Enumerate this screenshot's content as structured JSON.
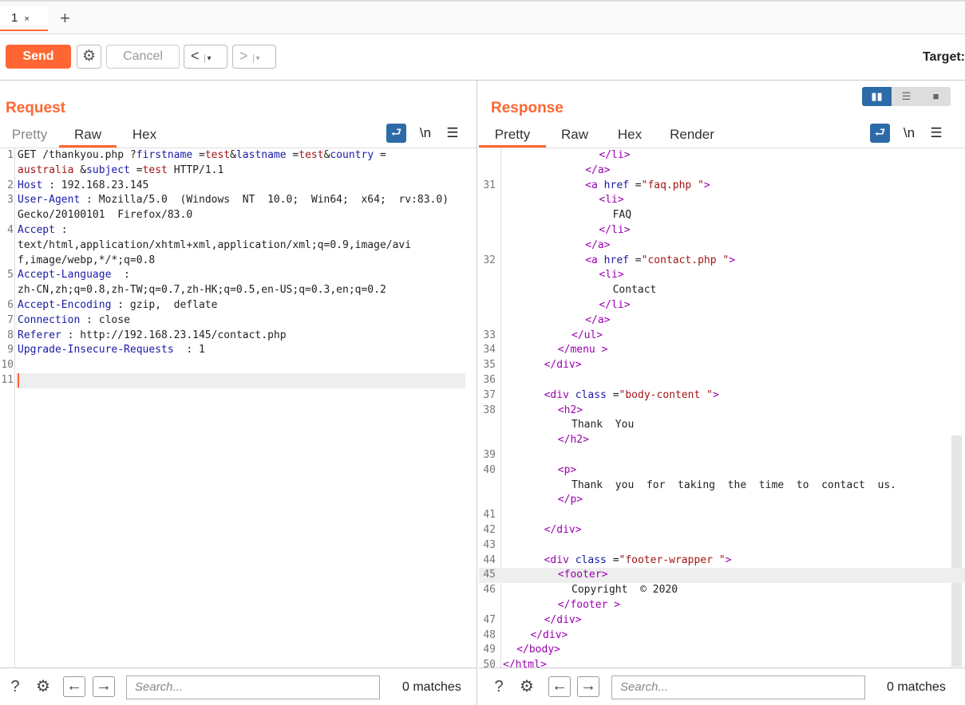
{
  "tabs": {
    "items": [
      {
        "label": "1",
        "close": "×"
      }
    ],
    "add": "+"
  },
  "toolbar": {
    "send": "Send",
    "cancel": "Cancel",
    "back": "<",
    "forward": ">",
    "dropdown": "▾",
    "target": "Target:"
  },
  "request": {
    "title": "Request",
    "tabs": [
      "Pretty",
      "Raw",
      "Hex"
    ],
    "active_tab": "Raw",
    "newline_label": "\\n",
    "lines": [
      {
        "n": "1",
        "parts": [
          [
            "GET /thankyou.php ?",
            ""
          ],
          [
            "firstname",
            "k"
          ],
          [
            " =",
            ""
          ],
          [
            "test",
            "v"
          ],
          [
            "&",
            ""
          ],
          [
            "lastname",
            "k"
          ],
          [
            " =",
            ""
          ],
          [
            "test",
            "v"
          ],
          [
            "&",
            ""
          ],
          [
            "country",
            "k"
          ],
          [
            " =",
            ""
          ]
        ]
      },
      {
        "n": "",
        "parts": [
          [
            "australia",
            "v"
          ],
          [
            " &",
            ""
          ],
          [
            "subject",
            "k"
          ],
          [
            " =",
            ""
          ],
          [
            "test",
            "v"
          ],
          [
            " HTTP/1.1",
            ""
          ]
        ]
      },
      {
        "n": "2",
        "parts": [
          [
            "Host",
            "k"
          ],
          [
            " : 192.168.23.145",
            ""
          ]
        ]
      },
      {
        "n": "3",
        "parts": [
          [
            "User-Agent",
            "k"
          ],
          [
            " : Mozilla/5.0  (Windows  NT  10.0;  Win64;  x64;  rv:83.0)",
            ""
          ]
        ]
      },
      {
        "n": "",
        "parts": [
          [
            "Gecko/20100101  Firefox/83.0",
            ""
          ]
        ]
      },
      {
        "n": "4",
        "parts": [
          [
            "Accept",
            "k"
          ],
          [
            " :",
            ""
          ]
        ]
      },
      {
        "n": "",
        "parts": [
          [
            "text/html,application/xhtml+xml,application/xml;q=0.9,image/avi",
            ""
          ]
        ]
      },
      {
        "n": "",
        "parts": [
          [
            "f,image/webp,*/*;q=0.8",
            ""
          ]
        ]
      },
      {
        "n": "5",
        "parts": [
          [
            "Accept-Language",
            "k"
          ],
          [
            "  :",
            ""
          ]
        ]
      },
      {
        "n": "",
        "parts": [
          [
            "zh-CN,zh;q=0.8,zh-TW;q=0.7,zh-HK;q=0.5,en-US;q=0.3,en;q=0.2",
            ""
          ]
        ]
      },
      {
        "n": "6",
        "parts": [
          [
            "Accept-Encoding",
            "k"
          ],
          [
            " : gzip,  deflate",
            ""
          ]
        ]
      },
      {
        "n": "7",
        "parts": [
          [
            "Connection",
            "k"
          ],
          [
            " : close",
            ""
          ]
        ]
      },
      {
        "n": "8",
        "parts": [
          [
            "Referer",
            "k"
          ],
          [
            " : http://192.168.23.145/contact.php",
            ""
          ]
        ]
      },
      {
        "n": "9",
        "parts": [
          [
            "Upgrade-Insecure-Requests",
            "k"
          ],
          [
            "  : 1",
            ""
          ]
        ]
      },
      {
        "n": "10",
        "parts": []
      },
      {
        "n": "11",
        "parts": [],
        "cursor": true
      }
    ],
    "footer": {
      "search_placeholder": "Search...",
      "matches": "0 matches"
    }
  },
  "response": {
    "title": "Response",
    "tabs": [
      "Pretty",
      "Raw",
      "Hex",
      "Render"
    ],
    "active_tab": "Pretty",
    "newline_label": "\\n",
    "lines": [
      {
        "n": "",
        "i": 7,
        "parts": [
          [
            "</li>",
            "t"
          ]
        ]
      },
      {
        "n": "",
        "i": 6,
        "parts": [
          [
            "</a>",
            "t"
          ]
        ]
      },
      {
        "n": "31",
        "i": 6,
        "parts": [
          [
            "<a ",
            "t"
          ],
          [
            "href",
            "k"
          ],
          [
            " =",
            ""
          ],
          [
            "\"faq.php \"",
            "v"
          ],
          [
            ">",
            "t"
          ]
        ]
      },
      {
        "n": "",
        "i": 7,
        "parts": [
          [
            "<li>",
            "t"
          ]
        ]
      },
      {
        "n": "",
        "i": 8,
        "parts": [
          [
            "FAQ",
            ""
          ]
        ]
      },
      {
        "n": "",
        "i": 7,
        "parts": [
          [
            "</li>",
            "t"
          ]
        ]
      },
      {
        "n": "",
        "i": 6,
        "parts": [
          [
            "</a>",
            "t"
          ]
        ]
      },
      {
        "n": "32",
        "i": 6,
        "parts": [
          [
            "<a ",
            "t"
          ],
          [
            "href",
            "k"
          ],
          [
            " =",
            ""
          ],
          [
            "\"contact.php \"",
            "v"
          ],
          [
            ">",
            "t"
          ]
        ]
      },
      {
        "n": "",
        "i": 7,
        "parts": [
          [
            "<li>",
            "t"
          ]
        ]
      },
      {
        "n": "",
        "i": 8,
        "parts": [
          [
            "Contact",
            ""
          ]
        ]
      },
      {
        "n": "",
        "i": 7,
        "parts": [
          [
            "</li>",
            "t"
          ]
        ]
      },
      {
        "n": "",
        "i": 6,
        "parts": [
          [
            "</a>",
            "t"
          ]
        ]
      },
      {
        "n": "33",
        "i": 5,
        "parts": [
          [
            "</ul>",
            "t"
          ]
        ]
      },
      {
        "n": "34",
        "i": 4,
        "parts": [
          [
            "</menu >",
            "t"
          ]
        ]
      },
      {
        "n": "35",
        "i": 3,
        "parts": [
          [
            "</div>",
            "t"
          ]
        ]
      },
      {
        "n": "36",
        "i": 0,
        "parts": []
      },
      {
        "n": "37",
        "i": 3,
        "parts": [
          [
            "<div ",
            "t"
          ],
          [
            "class",
            "k"
          ],
          [
            " =",
            ""
          ],
          [
            "\"body-content \"",
            "v"
          ],
          [
            ">",
            "t"
          ]
        ]
      },
      {
        "n": "38",
        "i": 4,
        "parts": [
          [
            "<h2>",
            "t"
          ]
        ]
      },
      {
        "n": "",
        "i": 5,
        "parts": [
          [
            "Thank  You",
            ""
          ]
        ]
      },
      {
        "n": "",
        "i": 4,
        "parts": [
          [
            "</h2>",
            "t"
          ]
        ]
      },
      {
        "n": "39",
        "i": 0,
        "parts": []
      },
      {
        "n": "40",
        "i": 4,
        "parts": [
          [
            "<p>",
            "t"
          ]
        ]
      },
      {
        "n": "",
        "i": 5,
        "parts": [
          [
            "Thank  you  for  taking  the  time  to  contact  us.",
            ""
          ]
        ]
      },
      {
        "n": "",
        "i": 4,
        "parts": [
          [
            "</p>",
            "t"
          ]
        ]
      },
      {
        "n": "41",
        "i": 0,
        "parts": []
      },
      {
        "n": "42",
        "i": 3,
        "parts": [
          [
            "</div>",
            "t"
          ]
        ]
      },
      {
        "n": "43",
        "i": 0,
        "parts": []
      },
      {
        "n": "44",
        "i": 3,
        "parts": [
          [
            "<div ",
            "t"
          ],
          [
            "class",
            "k"
          ],
          [
            " =",
            ""
          ],
          [
            "\"footer-wrapper \"",
            "v"
          ],
          [
            ">",
            "t"
          ]
        ]
      },
      {
        "n": "45",
        "i": 4,
        "parts": [
          [
            "<footer>",
            "t"
          ]
        ],
        "hl": true
      },
      {
        "n": "46",
        "i": 5,
        "parts": [
          [
            "Copyright  © 2020",
            ""
          ]
        ]
      },
      {
        "n": "",
        "i": 4,
        "parts": [
          [
            "</footer >",
            "t"
          ]
        ]
      },
      {
        "n": "47",
        "i": 3,
        "parts": [
          [
            "</div>",
            "t"
          ]
        ]
      },
      {
        "n": "48",
        "i": 2,
        "parts": [
          [
            "</div>",
            "t"
          ]
        ]
      },
      {
        "n": "49",
        "i": 1,
        "parts": [
          [
            "</body>",
            "t"
          ]
        ]
      },
      {
        "n": "50",
        "i": 0,
        "parts": [
          [
            "</html>",
            "t"
          ]
        ]
      }
    ],
    "footer": {
      "search_placeholder": "Search...",
      "matches": "0 matches"
    }
  },
  "colors": {
    "accent": "#ff6633",
    "blue": "#2d6aa8",
    "key": "#1a1aa6",
    "value": "#a31515",
    "tag": "#9b00b0"
  }
}
